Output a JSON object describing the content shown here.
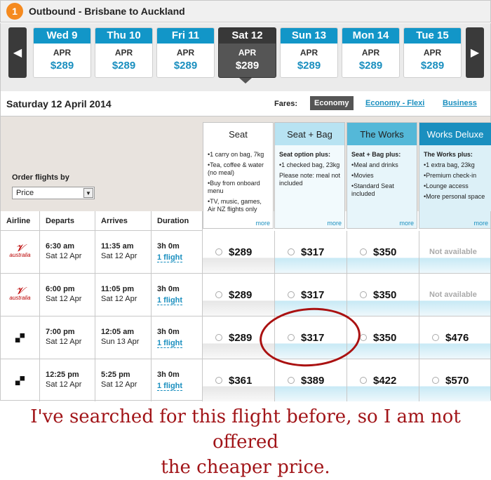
{
  "header": {
    "step": "1",
    "title": "Outbound - Brisbane to Auckland"
  },
  "dates": [
    {
      "day": "Wed 9",
      "month": "APR",
      "price": "$289"
    },
    {
      "day": "Thu 10",
      "month": "APR",
      "price": "$289"
    },
    {
      "day": "Fri 11",
      "month": "APR",
      "price": "$289"
    },
    {
      "day": "Sat 12",
      "month": "APR",
      "price": "$289",
      "selected": true
    },
    {
      "day": "Sun 13",
      "month": "APR",
      "price": "$289"
    },
    {
      "day": "Mon 14",
      "month": "APR",
      "price": "$289"
    },
    {
      "day": "Tue 15",
      "month": "APR",
      "price": "$289"
    }
  ],
  "farebar": {
    "selected_date": "Saturday 12 April 2014",
    "fares_label": "Fares:",
    "tabs": [
      "Economy",
      "Economy - Flexi",
      "Business"
    ]
  },
  "order": {
    "label": "Order flights by",
    "value": "Price"
  },
  "fare_columns": [
    {
      "title": "Seat",
      "intro": "",
      "items": [
        "1 carry on bag, 7kg",
        "Tea, coffee & water (no meal)",
        "Buy from onboard menu",
        "TV, music, games, Air NZ flights only"
      ],
      "more": "more"
    },
    {
      "title": "Seat + Bag",
      "intro": "Seat option plus:",
      "items": [
        "1 checked bag, 23kg",
        "Please note: meal not included"
      ],
      "more": "more"
    },
    {
      "title": "The Works",
      "intro": "Seat + Bag plus:",
      "items": [
        "Meal and drinks",
        "Movies",
        "Standard Seat included"
      ],
      "more": "more"
    },
    {
      "title": "Works Deluxe",
      "intro": "The Works plus:",
      "items": [
        "1 extra bag, 23kg",
        "Premium check-in",
        "Lounge access",
        "More personal space"
      ],
      "more": "more"
    }
  ],
  "table": {
    "headers": [
      "Airline",
      "Departs",
      "Arrives",
      "Duration"
    ],
    "rows": [
      {
        "airline": "australia",
        "dep_time": "6:30 am",
        "dep_date": "Sat 12 Apr",
        "arr_time": "11:35 am",
        "arr_date": "Sat 12 Apr",
        "duration": "3h 0m",
        "stops": "1 flight",
        "prices": [
          "$289",
          "$317",
          "$350",
          "Not available"
        ]
      },
      {
        "airline": "australia",
        "dep_time": "6:00 pm",
        "dep_date": "Sat 12 Apr",
        "arr_time": "11:05 pm",
        "arr_date": "Sat 12 Apr",
        "duration": "3h 0m",
        "stops": "1 flight",
        "prices": [
          "$289",
          "$317",
          "$350",
          "Not available"
        ]
      },
      {
        "airline": "",
        "dep_time": "7:00 pm",
        "dep_date": "Sat 12 Apr",
        "arr_time": "12:05 am",
        "arr_date": "Sun 13 Apr",
        "duration": "3h 0m",
        "stops": "1 flight",
        "prices": [
          "$289",
          "$317",
          "$350",
          "$476"
        ]
      },
      {
        "airline": "",
        "dep_time": "12:25 pm",
        "dep_date": "Sat 12 Apr",
        "arr_time": "5:25 pm",
        "arr_date": "Sat 12 Apr",
        "duration": "3h 0m",
        "stops": "1 flight",
        "prices": [
          "$361",
          "$389",
          "$422",
          "$570"
        ]
      }
    ]
  },
  "caption": {
    "line1": "I've searched for this flight before, so I am not offered",
    "line2": "the cheaper price."
  },
  "colors": {
    "accent": "#1a8fbf",
    "step": "#f58a1f",
    "annotation": "#a11418"
  }
}
